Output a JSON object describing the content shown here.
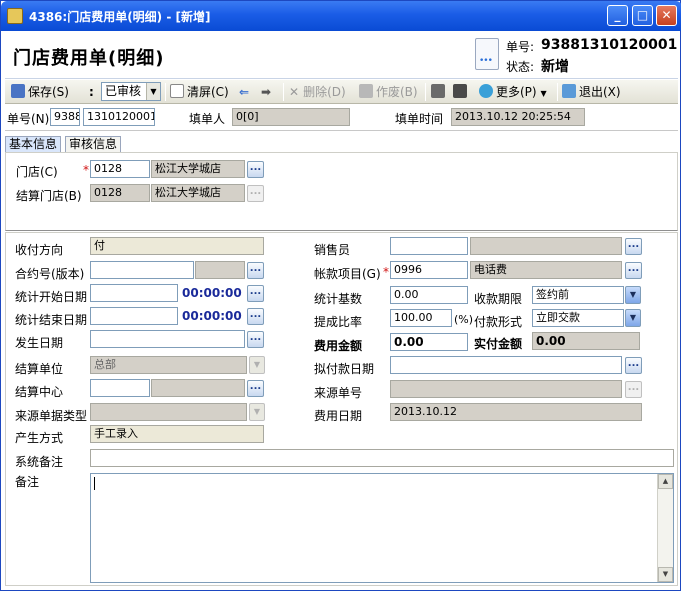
{
  "window": {
    "title": "4386:门店费用单(明细) - [新增]"
  },
  "header": {
    "page_title": "门店费用单(明细)",
    "doc_no_label": "单号:",
    "doc_no_value": "93881310120001",
    "status_label": "状态:",
    "status_value": "新增"
  },
  "toolbar": {
    "save": "保存(S)",
    "colon": ":",
    "audit_select": "已审核",
    "clear": "清屏(C)",
    "delete": "删除(D)",
    "void": "作废(B)",
    "more": "更多(P)",
    "exit": "退出(X)"
  },
  "info": {
    "doc_no_label": "单号(N)",
    "doc_no_prefix": "9388",
    "doc_no_suffix": "1310120001",
    "filler_label": "填单人",
    "filler_value": "0[0]",
    "fill_time_label": "填单时间",
    "fill_time_value": "2013.10.12 20:25:54"
  },
  "tabs": [
    "基本信息",
    "审核信息"
  ],
  "store": {
    "store_label": "门店(C)",
    "store_code": "0128",
    "store_name": "松江大学城店",
    "settle_label": "结算门店(B)",
    "settle_code": "0128",
    "settle_name": "松江大学城店"
  },
  "form": {
    "pay_dir_label": "收付方向",
    "pay_dir_value": "付",
    "contract_label": "合约号(版本)",
    "stat_start_label": "统计开始日期",
    "stat_start_time": "00:00:00",
    "stat_end_label": "统计结束日期",
    "stat_end_time": "00:00:00",
    "occur_date_label": "发生日期",
    "settle_unit_label": "结算单位",
    "settle_unit_value": "总部",
    "settle_center_label": "结算中心",
    "source_type_label": "来源单据类型",
    "gen_method_label": "产生方式",
    "gen_method_value": "手工录入",
    "salesman_label": "销售员",
    "account_item_label": "帐款项目(G)",
    "account_item_code": "0996",
    "account_item_name": "电话费",
    "stat_base_label": "统计基数",
    "stat_base_value": "0.00",
    "collect_term_label": "收款期限",
    "collect_term_value": "签约前",
    "commission_label": "提成比率",
    "commission_value": "100.00",
    "percent": "(%)",
    "pay_form_label": "付款形式",
    "pay_form_value": "立即交款",
    "fee_amount_label": "费用金额",
    "fee_amount_value": "0.00",
    "paid_amount_label": "实付金额",
    "paid_amount_value": "0.00",
    "plan_pay_date_label": "拟付款日期",
    "source_no_label": "来源单号",
    "fee_date_label": "费用日期",
    "fee_date_value": "2013.10.12",
    "sys_remark_label": "系统备注",
    "remark_label": "备注"
  }
}
